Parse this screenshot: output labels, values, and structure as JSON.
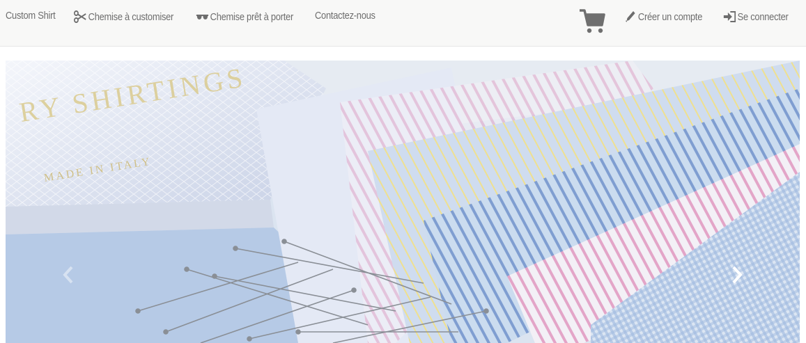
{
  "navbar": {
    "brand": "Custom Shirt",
    "links": [
      {
        "label": "Chemise à customiser",
        "icon": "scissors-icon"
      },
      {
        "label": "Chemise prêt à porter",
        "icon": "sunglasses-icon"
      },
      {
        "label": "Contactez-nous"
      }
    ],
    "cart_icon": "shopping-cart-icon",
    "account": {
      "label": "Créer un compte",
      "icon": "pencil-icon"
    },
    "login": {
      "label": "Se connecter",
      "icon": "sign-in-icon"
    }
  },
  "carousel": {
    "image_text": {
      "brand": "RY SHIRTINGS",
      "origin": "MADE IN ITALY"
    },
    "prev_icon": "chevron-left-icon",
    "next_icon": "chevron-right-icon"
  },
  "colors": {
    "navbar_bg": "#f8f8f7",
    "nav_text": "#6d6d6d",
    "cart": "#6f6f6f"
  }
}
